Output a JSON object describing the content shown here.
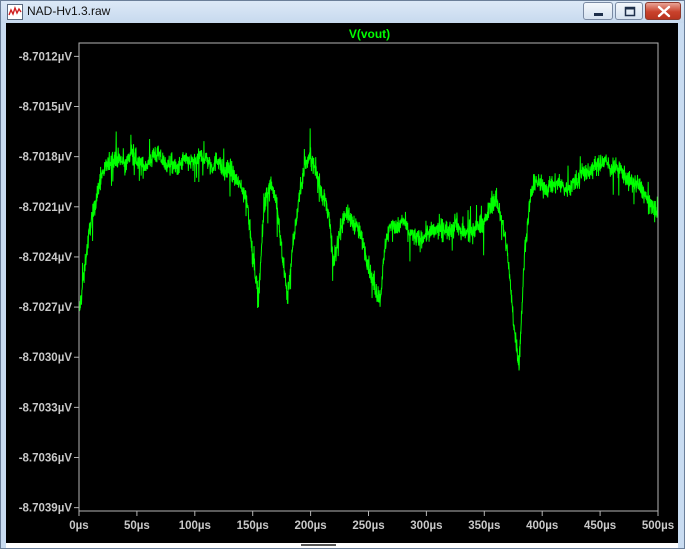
{
  "window": {
    "title": "NAD-Hv1.3.raw",
    "app_icon": "waveform-app-icon",
    "buttons": {
      "minimize": "minimize-icon",
      "maximize": "maximize-icon",
      "close": "close-icon"
    }
  },
  "colors": {
    "background": "#000000",
    "trace": "#00ff00",
    "axis_text": "#c8c8c8",
    "title": "#00ff00",
    "frame": "#b4b4b4"
  },
  "chart_data": {
    "type": "line",
    "title": "V(vout)",
    "xlabel": "",
    "ylabel": "",
    "xlim": [
      0,
      500
    ],
    "ylim": [
      -8.70392,
      -8.70112
    ],
    "x_ticks": [
      0,
      50,
      100,
      150,
      200,
      250,
      300,
      350,
      400,
      450,
      500
    ],
    "x_tick_labels": [
      "0µs",
      "50µs",
      "100µs",
      "150µs",
      "200µs",
      "250µs",
      "300µs",
      "350µs",
      "400µs",
      "450µs",
      "500µs"
    ],
    "y_ticks": [
      -8.7012,
      -8.7015,
      -8.7018,
      -8.7021,
      -8.7024,
      -8.7027,
      -8.703,
      -8.7033,
      -8.7036,
      -8.7039
    ],
    "y_tick_labels": [
      "-8.7012µV",
      "-8.7015µV",
      "-8.7018µV",
      "-8.7021µV",
      "-8.7024µV",
      "-8.7027µV",
      "-8.7030µV",
      "-8.7033µV",
      "-8.7036µV",
      "-8.7039µV"
    ],
    "grid": false,
    "legend": "none",
    "series": [
      {
        "x": [
          0,
          5,
          10,
          15,
          20,
          25,
          30,
          35,
          40,
          45,
          50,
          55,
          60,
          65,
          70,
          75,
          80,
          85,
          90,
          95,
          100,
          105,
          110,
          115,
          120,
          125,
          130,
          135,
          140,
          145,
          150,
          155,
          160,
          165,
          170,
          175,
          180,
          185,
          190,
          195,
          200,
          205,
          210,
          215,
          220,
          225,
          230,
          235,
          240,
          245,
          250,
          255,
          260,
          265,
          270,
          275,
          280,
          285,
          290,
          295,
          300,
          305,
          310,
          315,
          320,
          325,
          330,
          335,
          340,
          345,
          350,
          355,
          360,
          365,
          370,
          375,
          380,
          385,
          390,
          395,
          400,
          405,
          410,
          415,
          420,
          425,
          430,
          435,
          440,
          445,
          450,
          455,
          460,
          465,
          470,
          475,
          480,
          485,
          490,
          495,
          500
        ],
        "y": [
          -8.70275,
          -8.70245,
          -8.7022,
          -8.70205,
          -8.7019,
          -8.70185,
          -8.7018,
          -8.70182,
          -8.70185,
          -8.70178,
          -8.70182,
          -8.70186,
          -8.70184,
          -8.70178,
          -8.7018,
          -8.70185,
          -8.70184,
          -8.70188,
          -8.70182,
          -8.70183,
          -8.70184,
          -8.7018,
          -8.70181,
          -8.70186,
          -8.70181,
          -8.7019,
          -8.70186,
          -8.70194,
          -8.70198,
          -8.70205,
          -8.7024,
          -8.70263,
          -8.7021,
          -8.70195,
          -8.70205,
          -8.70235,
          -8.70265,
          -8.70232,
          -8.70205,
          -8.70185,
          -8.7018,
          -8.7019,
          -8.70203,
          -8.7021,
          -8.70245,
          -8.70225,
          -8.70213,
          -8.70218,
          -8.70222,
          -8.7023,
          -8.70245,
          -8.70258,
          -8.70265,
          -8.7023,
          -8.70219,
          -8.70223,
          -8.70218,
          -8.70225,
          -8.70228,
          -8.7023,
          -8.70226,
          -8.70225,
          -8.70224,
          -8.70222,
          -8.70225,
          -8.70218,
          -8.70225,
          -8.70226,
          -8.70225,
          -8.7022,
          -8.7022,
          -8.7021,
          -8.70205,
          -8.70217,
          -8.70237,
          -8.70277,
          -8.70305,
          -8.70235,
          -8.70203,
          -8.70195,
          -8.70198,
          -8.70199,
          -8.70197,
          -8.70195,
          -8.702,
          -8.70197,
          -8.70195,
          -8.70189,
          -8.7019,
          -8.70186,
          -8.70185,
          -8.70182,
          -8.70188,
          -8.70186,
          -8.7019,
          -8.70195,
          -8.70196,
          -8.70198,
          -8.70205,
          -8.7021,
          -8.70215
        ]
      }
    ]
  }
}
